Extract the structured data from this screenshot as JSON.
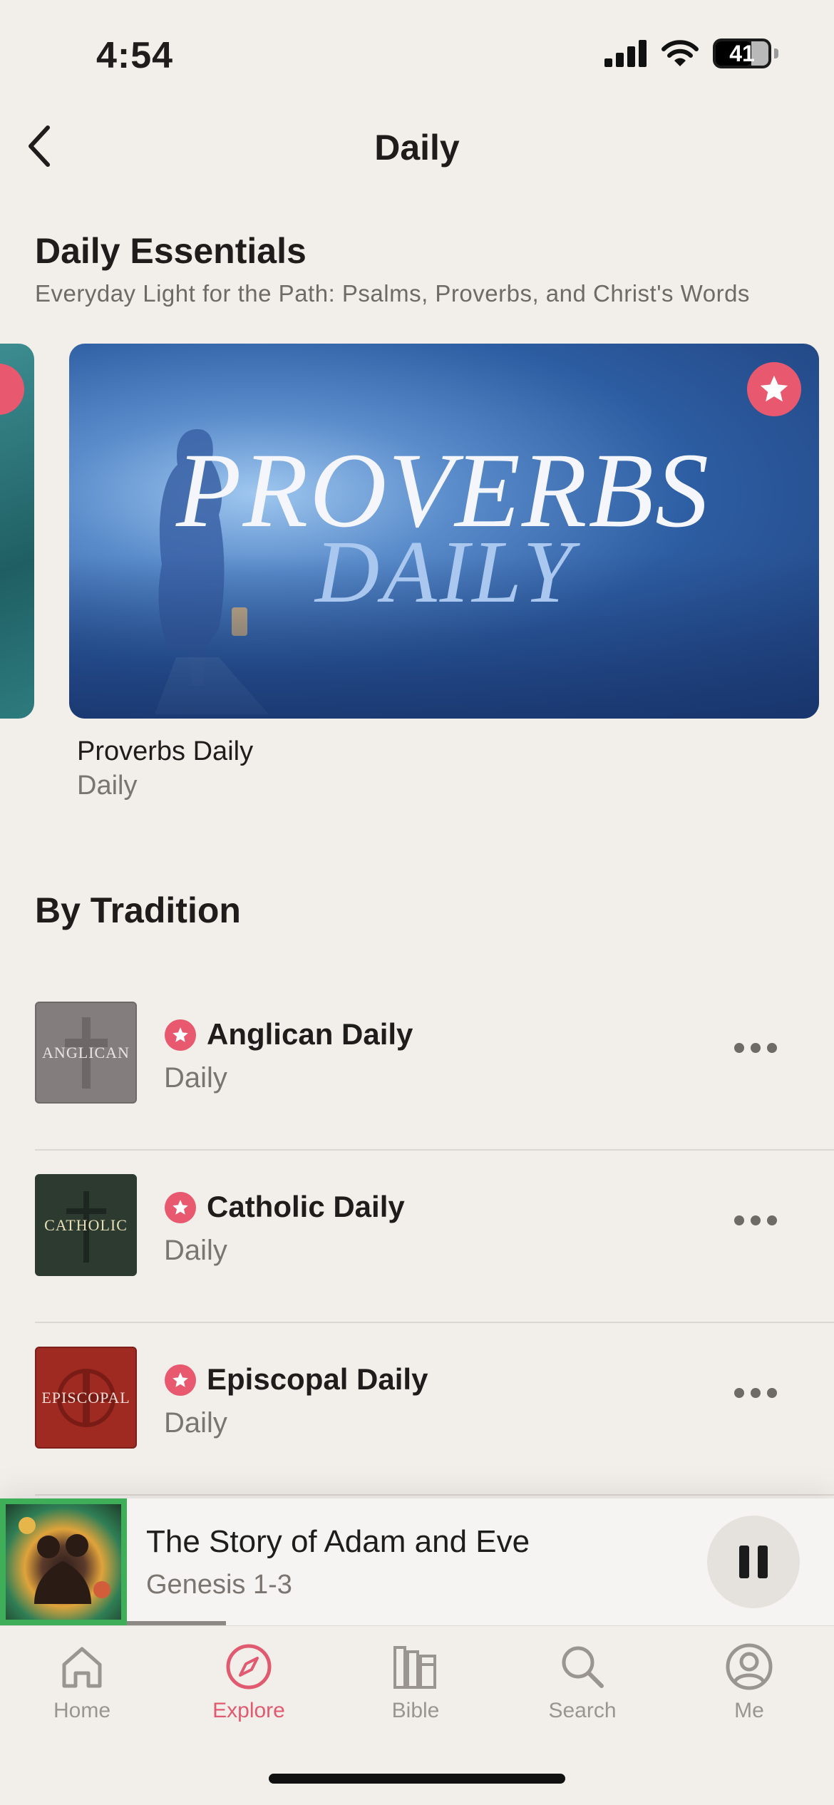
{
  "status_bar": {
    "time": "4:54",
    "battery": "41"
  },
  "nav": {
    "title": "Daily"
  },
  "daily_essentials": {
    "title": "Daily Essentials",
    "subtitle": "Everyday Light for the Path: Psalms, Proverbs, and Christ's Words",
    "feature": {
      "art_title": "PROVERBS",
      "art_subtitle": "DAILY",
      "name": "Proverbs Daily",
      "category": "Daily"
    }
  },
  "by_tradition": {
    "title": "By Tradition",
    "items": [
      {
        "title": "Anglican Daily",
        "subtitle": "Daily",
        "thumb_text": "ANGLICAN",
        "thumb_color": "#837d7d"
      },
      {
        "title": "Catholic Daily",
        "subtitle": "Daily",
        "thumb_text": "CATHOLIC",
        "thumb_color": "#2c3a30"
      },
      {
        "title": "Episcopal Daily",
        "subtitle": "Daily",
        "thumb_text": "EPISCOPAL",
        "thumb_color": "#9e2a22"
      }
    ]
  },
  "player": {
    "title": "The Story of Adam and Eve",
    "subtitle": "Genesis 1-3",
    "progress": 0.14
  },
  "tabs": [
    {
      "label": "Home",
      "icon": "home-icon"
    },
    {
      "label": "Explore",
      "icon": "compass-icon",
      "active": true
    },
    {
      "label": "Bible",
      "icon": "bible-books-icon"
    },
    {
      "label": "Search",
      "icon": "search-icon"
    },
    {
      "label": "Me",
      "icon": "profile-icon"
    }
  ],
  "colors": {
    "accent": "#e05a70",
    "background": "#f2efeb",
    "badge": "#e8596f"
  }
}
